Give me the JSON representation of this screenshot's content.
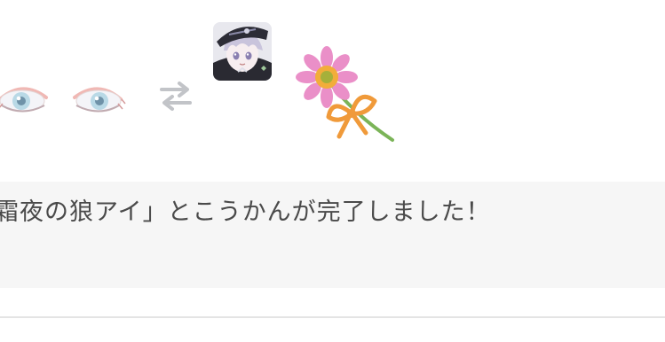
{
  "exchange": {
    "given_item_icon": "eye-pair-icon",
    "swap_icon": "swap-arrows-icon",
    "received_item_icon": "character-avatar-icon",
    "celebration_icon": "flower-with-ribbon-icon"
  },
  "message": {
    "text": "霜夜の狼アイ」とこうかんが完了しました！"
  },
  "colors": {
    "message_background": "#f6f6f6",
    "message_text": "#4a4a4a",
    "swap_icon": "#c2c4c8",
    "divider": "#e4e4e4"
  }
}
